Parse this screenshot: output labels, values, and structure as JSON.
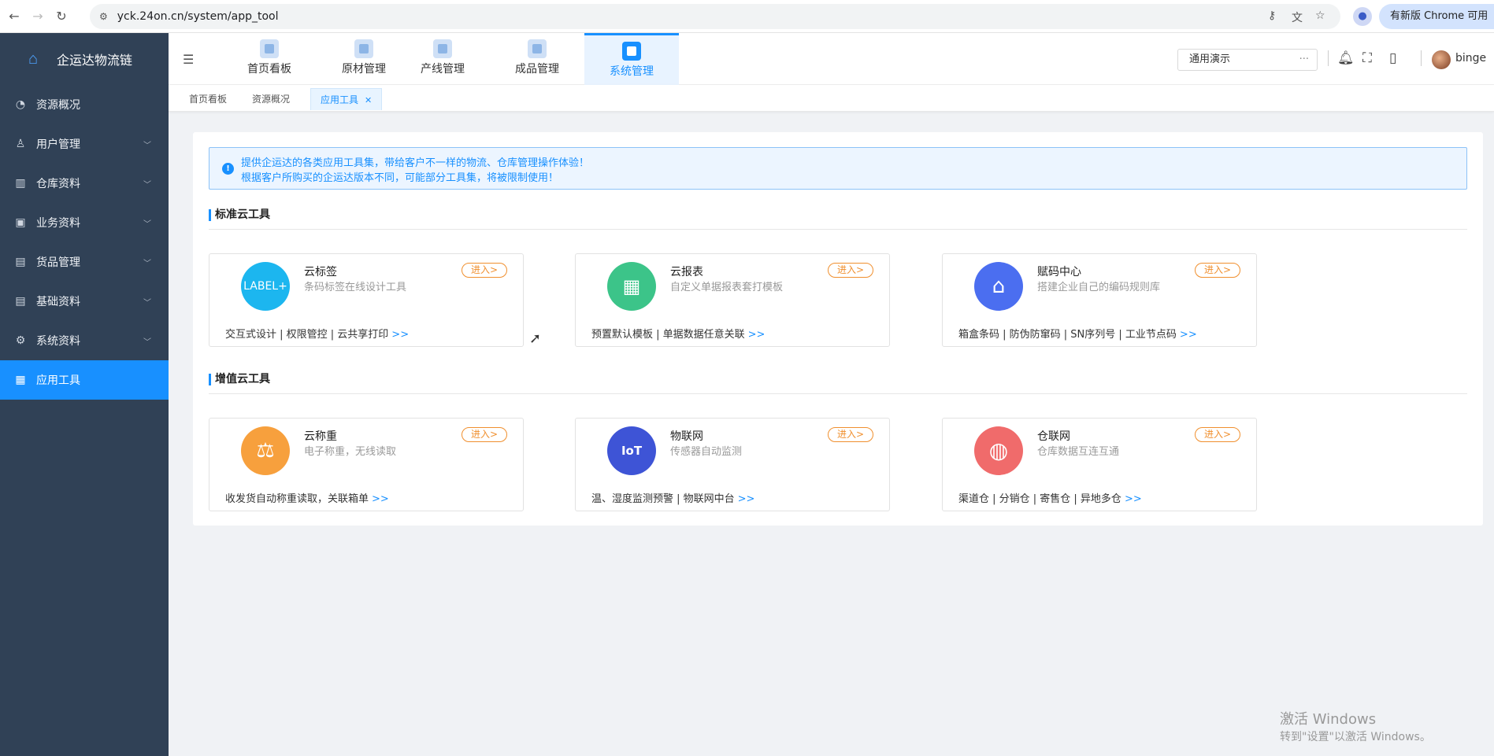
{
  "browser": {
    "url": "yck.24on.cn/system/app_tool",
    "update_label": "有新版 Chrome 可用"
  },
  "sidebar": {
    "brand": "企运达物流链",
    "items": [
      {
        "label": "资源概况",
        "icon": "pie-chart-icon"
      },
      {
        "label": "用户管理",
        "icon": "user-icon"
      },
      {
        "label": "仓库资料",
        "icon": "building-icon"
      },
      {
        "label": "业务资料",
        "icon": "briefcase-icon"
      },
      {
        "label": "货品管理",
        "icon": "box-icon"
      },
      {
        "label": "基础资料",
        "icon": "document-icon"
      },
      {
        "label": "系统资料",
        "icon": "gear-icon"
      },
      {
        "label": "应用工具",
        "icon": "grid-icon"
      }
    ]
  },
  "header": {
    "modules": [
      "首页看板",
      "原材管理",
      "产线管理",
      "成品管理",
      "系统管理"
    ],
    "company_select": "通用演示",
    "user": "binge"
  },
  "tabs": [
    "首页看板",
    "资源概况",
    "应用工具"
  ],
  "notice": {
    "line1": "提供企运达的各类应用工具集，带给客户不一样的物流、仓库管理操作体验！",
    "line2": "根据客户所购买的企运达版本不同，可能部分工具集，将被限制使用！"
  },
  "sections": [
    {
      "title": "标准云工具",
      "tools": [
        {
          "name": "云标签",
          "desc": "条码标签在线设计工具",
          "features": "交互式设计 | 权限管控 | 云共享打印",
          "badge": "LABEL+",
          "color": "#1cb6ef"
        },
        {
          "name": "云报表",
          "desc": "自定义单据报表套打模板",
          "features": "预置默认模板 | 单据数据任意关联",
          "badge": "▦",
          "color": "#3cc489"
        },
        {
          "name": "赋码中心",
          "desc": "搭建企业自己的编码规则库",
          "features": "箱盒条码 | 防伪防窜码 | SN序列号 | 工业节点码",
          "badge": "⌂",
          "color": "#4b6ef0"
        }
      ]
    },
    {
      "title": "增值云工具",
      "tools": [
        {
          "name": "云称重",
          "desc": "电子称重，无线读取",
          "features": "收发货自动称重读取，关联箱单",
          "badge": "⚖",
          "color": "#f7a03d"
        },
        {
          "name": "物联网",
          "desc": "传感器自动监测",
          "features": "温、湿度监测预警 | 物联网中台",
          "badge": "IoT",
          "color": "#3e54d6"
        },
        {
          "name": "仓联网",
          "desc": "仓库数据互连互通",
          "features": "渠道仓 | 分销仓 | 寄售仓 | 异地多仓",
          "badge": "◍",
          "color": "#f06b6b"
        }
      ]
    }
  ],
  "enter_label": "进入>",
  "more_label": ">>",
  "watermark": {
    "line1": "激活 Windows",
    "line2": "转到\"设置\"以激活 Windows。"
  }
}
